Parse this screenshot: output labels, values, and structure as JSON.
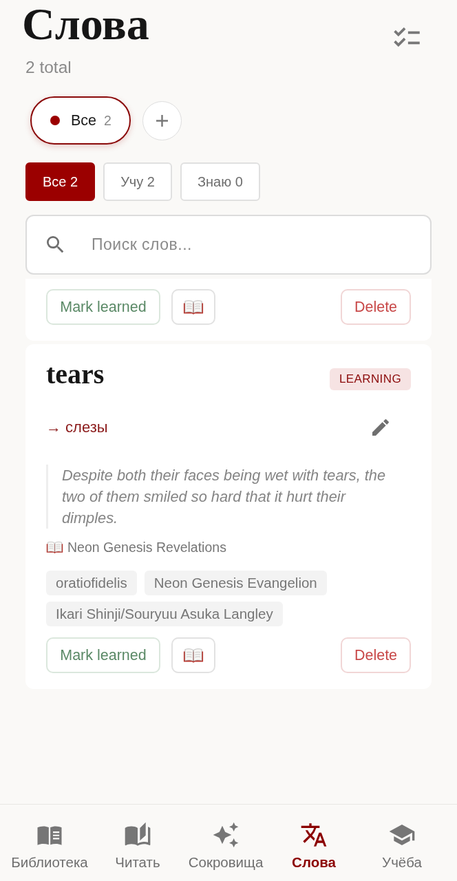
{
  "header": {
    "title": "Слова",
    "subtitle": "2 total"
  },
  "collections": [
    {
      "label": "Все",
      "count": "2",
      "color": "#9b0000",
      "selected": true
    }
  ],
  "filters": [
    {
      "label": "Все 2",
      "selected": true
    },
    {
      "label": "Учу 2",
      "selected": false
    },
    {
      "label": "Знаю 0",
      "selected": false
    }
  ],
  "search": {
    "placeholder": "Поиск слов..."
  },
  "words": [
    {
      "actions": {
        "learn": "Mark learned",
        "delete": "Delete"
      }
    },
    {
      "word": "tears",
      "status": "LEARNING",
      "translation": "→ слезы",
      "example": "Despite both their faces being wet with tears, the two of them smiled so hard that it hurt their dimples.",
      "source": "Neon Genesis Revelations",
      "tags": [
        "oratiofidelis",
        "Neon Genesis Evangelion",
        "Ikari Shinji/Souryuu Asuka Langley"
      ],
      "actions": {
        "learn": "Mark learned",
        "delete": "Delete"
      }
    }
  ],
  "nav": [
    {
      "label": "Библиотека",
      "selected": false
    },
    {
      "label": "Читать",
      "selected": false
    },
    {
      "label": "Сокровища",
      "selected": false
    },
    {
      "label": "Слова",
      "selected": true
    },
    {
      "label": "Учёба",
      "selected": false
    }
  ]
}
